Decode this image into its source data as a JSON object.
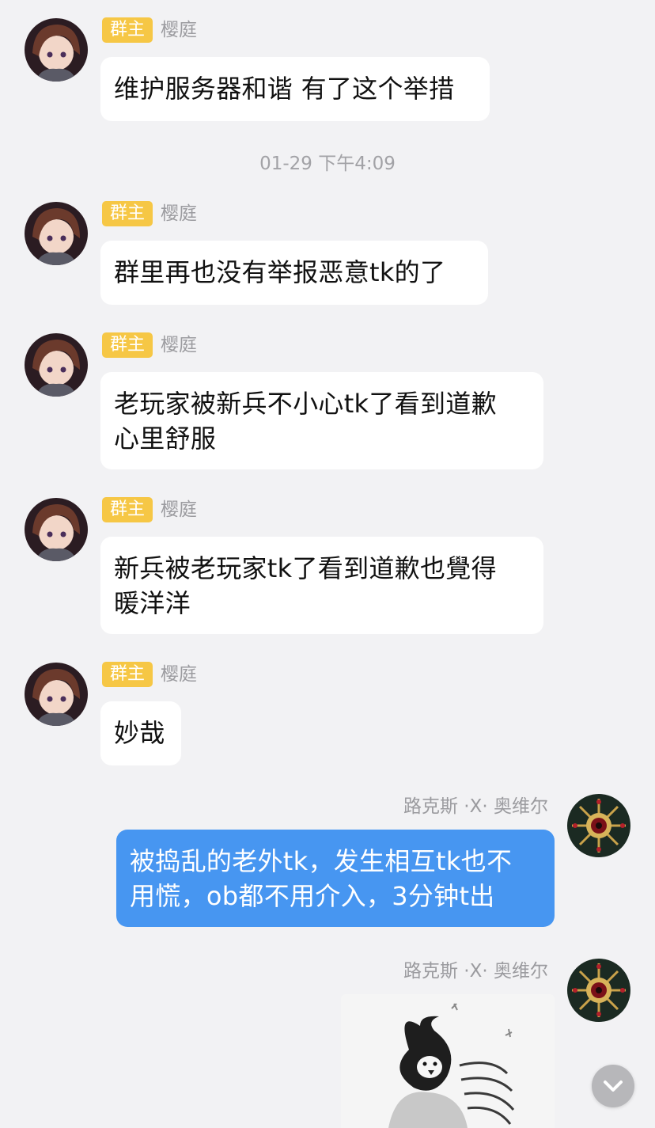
{
  "colors": {
    "background": "#f2f2f4",
    "bubble_incoming": "#ffffff",
    "bubble_outgoing": "#4796f1",
    "owner_badge": "#f6c745",
    "meta_text": "#9b9b9f"
  },
  "messages": [
    {
      "badge": "群主",
      "sender": "樱庭",
      "text": "维护服务器和谐 有了这个举措"
    },
    {
      "badge": "群主",
      "sender": "樱庭",
      "text": "群里再也没有举报恶意tk的了"
    },
    {
      "badge": "群主",
      "sender": "樱庭",
      "line1": "老玩家被新兵不小心tk了看到道歉",
      "line2": "心里舒服"
    },
    {
      "badge": "群主",
      "sender": "樱庭",
      "line1": "新兵被老玩家tk了看到道歉也覺得",
      "line2": "暖洋洋"
    },
    {
      "badge": "群主",
      "sender": "樱庭",
      "text": "妙哉"
    },
    {
      "sender": "路克斯 ·X· 奥维尔",
      "line1": "被捣乱的老外tk，发生相互tk也不",
      "line2": "用慌，ob都不用介入，3分钟t出"
    },
    {
      "sender": "路克斯 ·X· 奥维尔",
      "sticker": "penguin-meme-sticker"
    }
  ],
  "timestamp": "01-29 下午4:09",
  "icons": {
    "avatar_incoming": "anime-girl-avatar",
    "avatar_outgoing": "ornate-emblem-avatar",
    "scroll_down": "chevron-down-icon"
  }
}
